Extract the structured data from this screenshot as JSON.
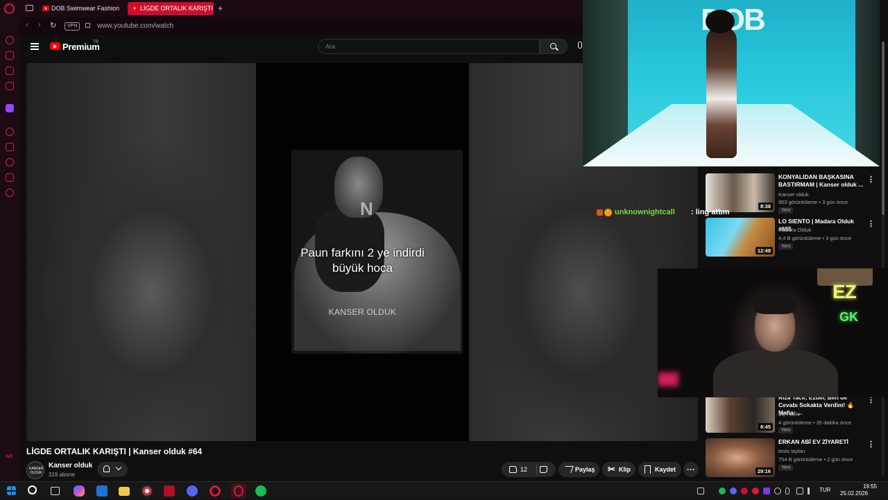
{
  "browser": {
    "tabs": [
      {
        "label": "DOB Swimwear Fashion Sh"
      },
      {
        "label": "LİGDE ORTALIK KARIŞTI |"
      }
    ],
    "new_tab": "+",
    "vpn": "VPN",
    "url": "www.youtube.com/watch"
  },
  "youtube": {
    "logo_text": "Premium",
    "logo_badge": "TR",
    "search_placeholder": "Ara"
  },
  "video": {
    "caption_line1": "Paun farkını 2 ye indirdi",
    "caption_line2": "büyük hoca",
    "watermark": "KANSER OLDUK",
    "corner_letter": "N",
    "title": "LİGDE ORTALIK KARIŞTI | Kanser olduk #64",
    "channel": "Kanser olduk",
    "channel_avatar_text": "KANSER OLDUK",
    "subscribers": "319 abone",
    "likes": "12",
    "share": "Paylaş",
    "clip": "Klip",
    "save": "Kaydet",
    "more": "···"
  },
  "recommendations": [
    {
      "title": "KONYALIDAN BAŞKASINA BASTIRMAM | Kanser olduk ...",
      "channel": "Kanser olduk",
      "meta": "953 görüntüleme • 3 gün önce",
      "badge": "Yeni",
      "duration": "8:38"
    },
    {
      "title": "LO SIENTO | Madara Olduk #655",
      "channel": "Madara Olduk",
      "meta": "4,4 B görüntüleme • 3 gün önce",
      "badge": "Yeni",
      "duration": "12:48"
    },
    {
      "title": "Rıza Tacir, Ezdel, Ben de Cevabı Sokakta Verdim! 🔥 Mafia: ...",
      "channel": "METWİN",
      "meta": "4 görüntüleme • 35 dakika önce",
      "badge": "Yeni",
      "duration": "8:45"
    },
    {
      "title": "ERKAN ABİ EV ZİYARETİ",
      "channel": "testo taylan",
      "meta": "754 B görüntüleme • 2 gün önce",
      "badge": "Yeni",
      "duration": "29:16"
    }
  ],
  "overlays": {
    "runway_logo": "DOB",
    "chat_user": "unknownightcall",
    "chat_message": ": ling attım",
    "neon_top": "EZ",
    "neon_bottom": "GK"
  },
  "taskbar": {
    "language": "TUR",
    "time": "19:55",
    "date": "25.02.2026"
  },
  "colors": {
    "accent": "#c8102e",
    "youtube_red": "#ff0000",
    "chat_name": "#7dd83c"
  }
}
